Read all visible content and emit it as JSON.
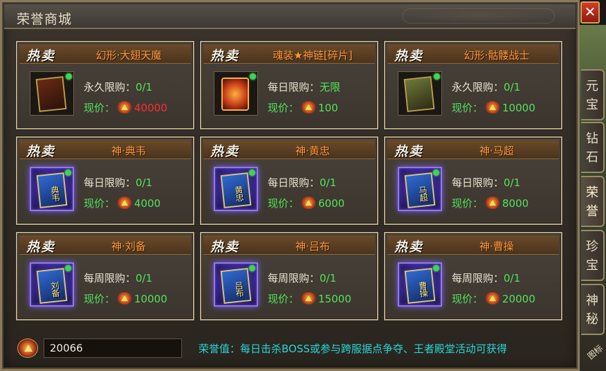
{
  "window": {
    "title": "荣誉商城",
    "close_label": "✕"
  },
  "hot_label": "热卖",
  "items": [
    {
      "name": "幻形·大翅天魔",
      "limit_type": "永久限购：",
      "limit_value": "0/1",
      "price_label": "现价：",
      "price": "40000",
      "price_color": "red",
      "art": "wings",
      "art_text": ""
    },
    {
      "name": "魂装★神链[碎片]",
      "limit_type": "每日限购：",
      "limit_value": "无限",
      "price_label": "现价：",
      "price": "100",
      "price_color": "green",
      "art": "fire",
      "art_text": ""
    },
    {
      "name": "幻形·骷髅战士",
      "limit_type": "永久限购：",
      "limit_value": "0/1",
      "price_label": "现价：",
      "price": "10000",
      "price_color": "green",
      "art": "skeleton",
      "art_text": ""
    },
    {
      "name": "神·典韦",
      "limit_type": "每日限购：",
      "limit_value": "0/1",
      "price_label": "现价：",
      "price": "4000",
      "price_color": "green",
      "art": "card",
      "art_text": "典韦"
    },
    {
      "name": "神·黄忠",
      "limit_type": "每日限购：",
      "limit_value": "0/1",
      "price_label": "现价：",
      "price": "6000",
      "price_color": "green",
      "art": "card",
      "art_text": "黄忠"
    },
    {
      "name": "神·马超",
      "limit_type": "每日限购：",
      "limit_value": "0/1",
      "price_label": "现价：",
      "price": "8000",
      "price_color": "green",
      "art": "card",
      "art_text": "马超"
    },
    {
      "name": "神·刘备",
      "limit_type": "每周限购：",
      "limit_value": "0/1",
      "price_label": "现价：",
      "price": "10000",
      "price_color": "green",
      "art": "card",
      "art_text": "刘备"
    },
    {
      "name": "神·吕布",
      "limit_type": "每周限购：",
      "limit_value": "0/1",
      "price_label": "现价：",
      "price": "15000",
      "price_color": "green",
      "art": "card",
      "art_text": "吕布"
    },
    {
      "name": "神·曹操",
      "limit_type": "每周限购：",
      "limit_value": "0/1",
      "price_label": "现价：",
      "price": "20000",
      "price_color": "green",
      "art": "card",
      "art_text": "曹操"
    }
  ],
  "footer": {
    "honor_value": "20066",
    "note": "荣誉值：每日击杀BOSS或参与跨服据点争夺、王者殿堂活动可获得"
  },
  "side_tabs": [
    {
      "label": "元宝",
      "active": false
    },
    {
      "label": "钻石",
      "active": false
    },
    {
      "label": "荣誉",
      "active": true
    },
    {
      "label": "珍宝",
      "active": false
    },
    {
      "label": "神秘",
      "active": false
    }
  ],
  "corner_text": "图标"
}
